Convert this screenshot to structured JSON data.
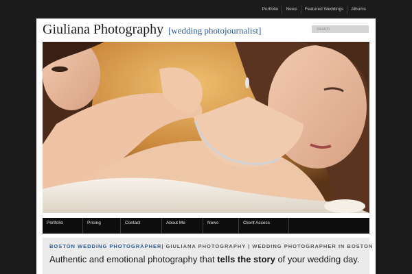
{
  "top_nav": [
    "Portfolio",
    "News",
    "Featured Weddings",
    "Albums"
  ],
  "header": {
    "site_title": "Giuliana Photography",
    "tagline": "[wedding photojournalist]",
    "search_placeholder": "Search"
  },
  "main_nav": [
    "Portfolio",
    "Pricing",
    "Contact",
    "About Me",
    "News",
    "Client Access"
  ],
  "content": {
    "keyword_highlight": "BOSTON WEDDING PHOTOGRAPHER",
    "keyword_rest": "| GIULIANA PHOTOGRAPHY | WEDDING PHOTOGRAPHER IN BOSTON",
    "intro_before": "Authentic and emotional photography that ",
    "intro_bold": "tells the story",
    "intro_after": " of your wedding day."
  },
  "colors": {
    "background": "#1b1b1b",
    "accent_blue": "#2a5a9c",
    "nav_bar": "#0d0d0d",
    "content_panel": "#ebebeb"
  }
}
